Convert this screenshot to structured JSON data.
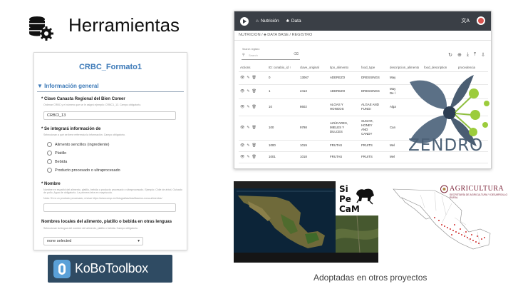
{
  "slide": {
    "title": "Herramientas",
    "caption": "Adoptadas en otros proyectos"
  },
  "kobo_form": {
    "title": "CRBC_Formato1",
    "section": "Información general",
    "q1_label": "Clave Canasta Regional del Bien Comer",
    "q1_hint": "Ordenar CRBC y el número que se le asignó ejemplo: CRBC1_13. Campo obligatorio.",
    "q1_value": "CRBCI_13",
    "q2_label": "Se integrará información de",
    "q2_hint": "Seleccionar a qué se tiene referencia la información. Campo obligatorio.",
    "q2_options": [
      "Alimento sencillos (ingrediente)",
      "Platillo",
      "Bebida",
      "Producto procesado o ultraprocesado"
    ],
    "q3_label": "Nombre",
    "q3_hint": "Nombre en español del alimento, platillo, bebida o producto procesado o ultraprocesado. Ejemplo: Chile de árbol, Guisado de pollo, Agua de obligatorio. La primera letra en mayúscula.",
    "q3_hint2": "Nota: Si es un producto procesado, revisar https://www.cnsp.mx/fotografias/clasificacion-nova-alimentos/",
    "q4_label": "Nombres locales del alimento, platillo o bebida en otras lenguas",
    "q4_hint": "Seleccionar la lengua del nombre del alimento, platillo o bebida. Campo obligatorio.",
    "q4_value": "none selected",
    "dropdown_icon": "chevron-down-icon"
  },
  "kobo_logo": {
    "text": "KoBoToolbox"
  },
  "data_app": {
    "nav_home": "Nutrición",
    "nav_data": "Data",
    "breadcrumb": "NUTRICION / ♣ DATA BASE / REGISTRO",
    "search_label": "Search registro",
    "search_placeholder": "Search",
    "toolbar_icons": [
      "refresh-icon",
      "add-icon",
      "download-icon",
      "upload-icon",
      "export-icon"
    ],
    "columns": [
      "Actions",
      "ID: conabio_id ↑",
      "clave_original",
      "tipo_alimento",
      "food_type",
      "descripcion_alimento",
      "food_description",
      "procedencia"
    ],
    "rows": [
      {
        "id": "0",
        "clave": "13067",
        "tipo": "ADEREZO",
        "food": "DRESSINGS",
        "desc": "May"
      },
      {
        "id": "1",
        "clave": "2413",
        "tipo": "ADEREZO",
        "food": "DRESSINGS",
        "desc": "May\nDe l"
      },
      {
        "id": "10",
        "clave": "8602",
        "tipo": "ALGAS Y\nHONGOS",
        "food": "ALGAE AND\nFUNGI",
        "desc": "Alga"
      },
      {
        "id": "100",
        "clave": "9798",
        "tipo": "AZÚCARES,\nMIELES Y\nDULCES",
        "food": "SUGAR,\nHONEY\nAND\nCANDY",
        "desc": "Can"
      },
      {
        "id": "1000",
        "clave": "1019",
        "tipo": "FRUTAS",
        "food": "FRUITS",
        "desc": "Mel"
      },
      {
        "id": "1001",
        "clave": "1018",
        "tipo": "FRUTAS",
        "food": "FRUITS",
        "desc": "Mel"
      }
    ]
  },
  "zendro_logo": {
    "text": "ZENDRO"
  },
  "sipecam_logo": {
    "line1": "Si",
    "line2": "Pe",
    "line3": "CaM"
  },
  "agricultura_logo": {
    "text": "AGRICULTURA",
    "subtext": "SECRETARÍA DE AGRICULTURA Y DESARROLLO RURAL"
  }
}
